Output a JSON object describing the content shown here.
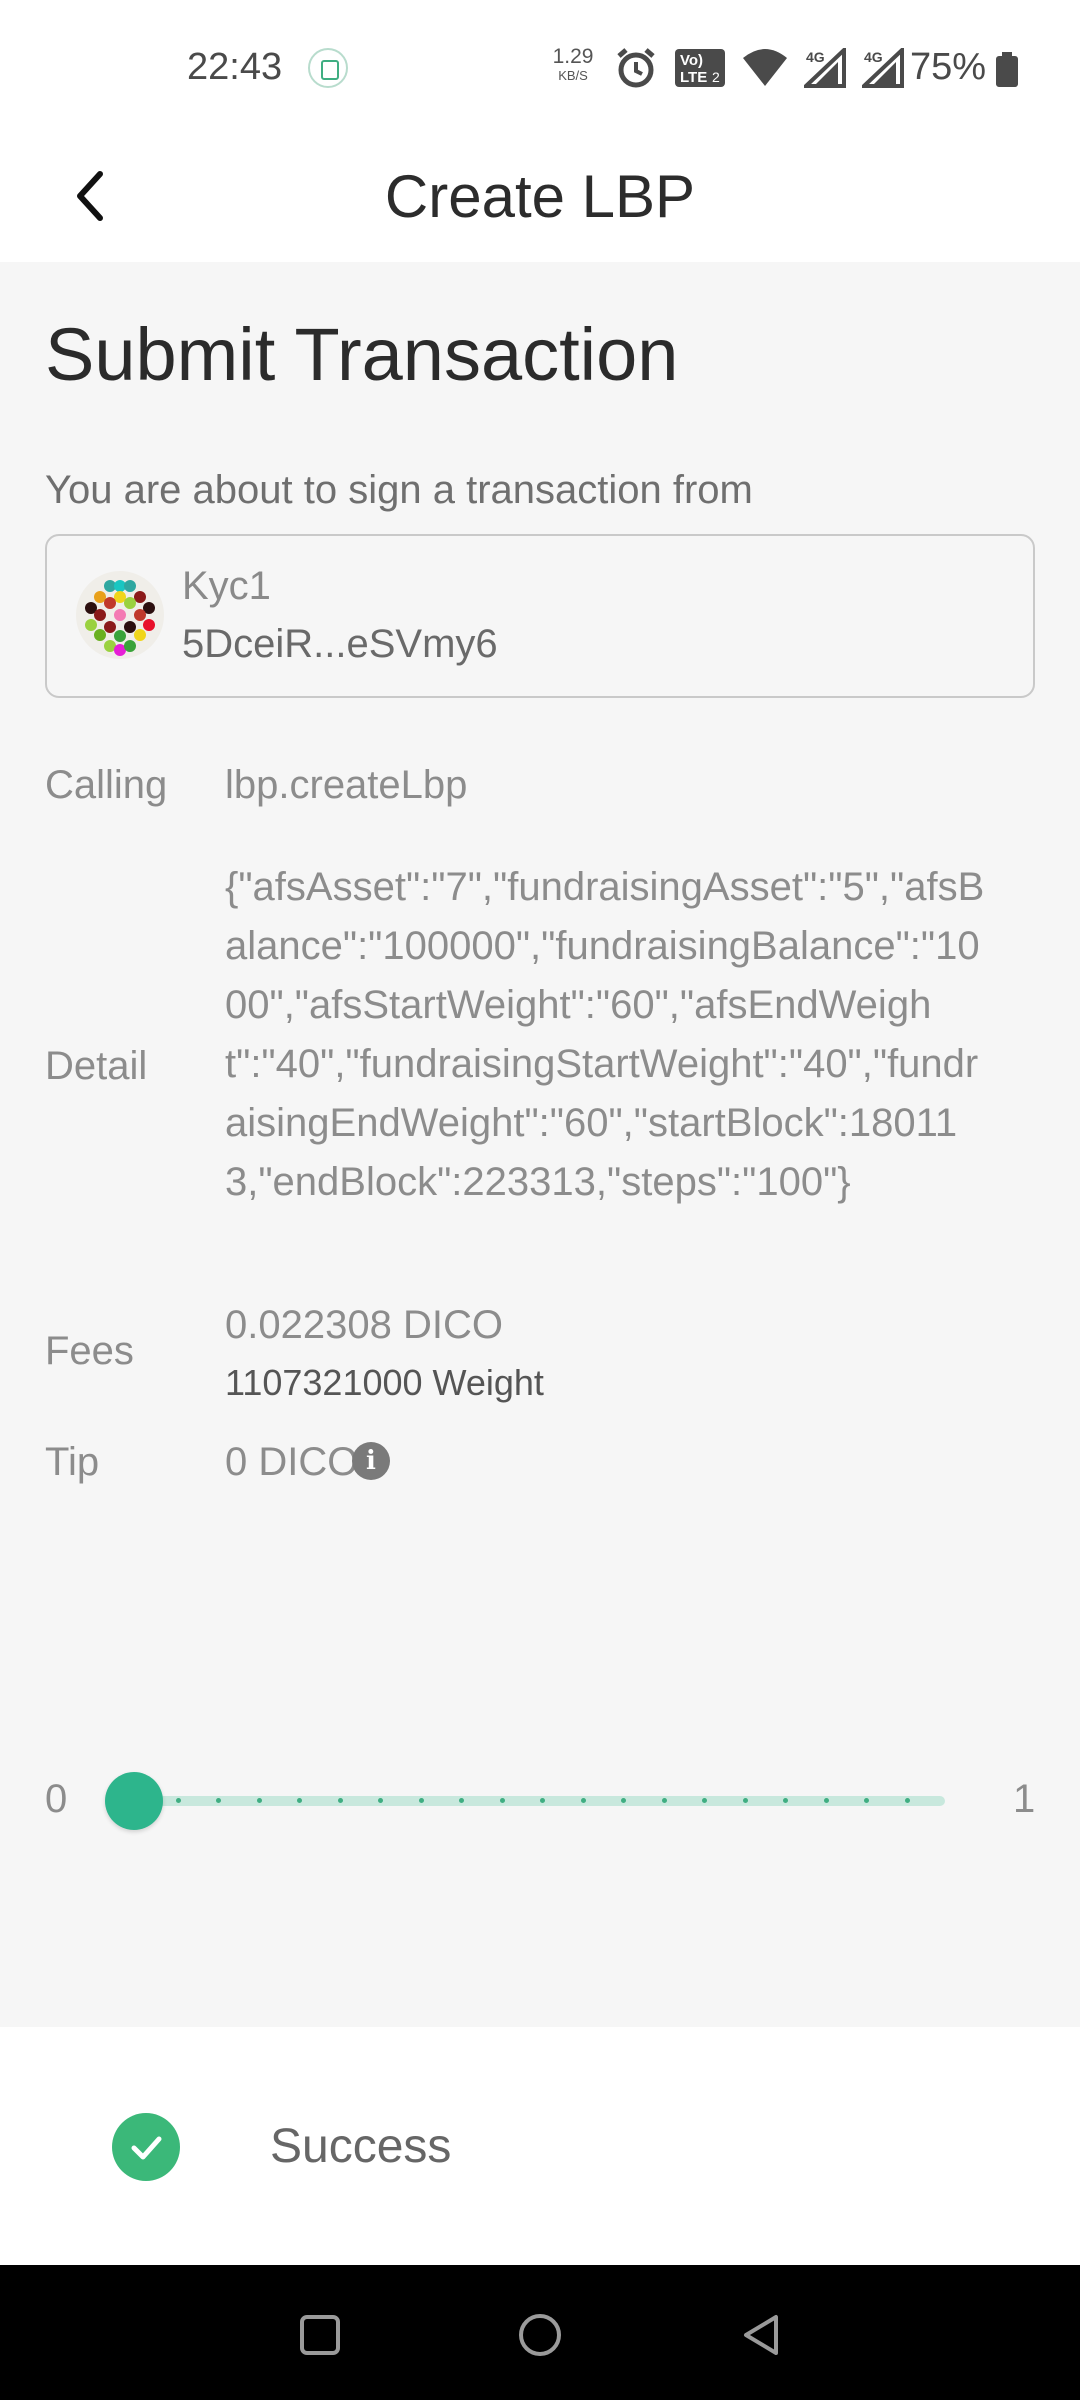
{
  "status_bar": {
    "time": "22:43",
    "net_speed_value": "1.29",
    "net_speed_unit": "KB/S",
    "volte_label": "Vo) LTE 2",
    "signal_label_1": "4G",
    "signal_label_2": "4G",
    "battery": "75%",
    "icons": [
      "app-notification-icon",
      "alarm-icon",
      "volte-icon",
      "wifi-icon",
      "signal-4g-icon",
      "signal-4g-icon",
      "battery-icon"
    ]
  },
  "app_bar": {
    "title": "Create LBP",
    "back_icon": "chevron-left-icon"
  },
  "page": {
    "heading": "Submit Transaction",
    "intro": "You are about to sign a transaction from",
    "account": {
      "name": "Kyc1",
      "address": "5DceiR...eSVmy6"
    },
    "calling_label": "Calling",
    "calling_value": "lbp.createLbp",
    "detail_label": "Detail",
    "detail_value": "{\"afsAsset\":\"7\",\"fundraisingAsset\":\"5\",\"afsBalance\":\"100000\",\"fundraisingBalance\":\"1000\",\"afsStartWeight\":\"60\",\"afsEndWeight\":\"40\",\"fundraisingStartWeight\":\"40\",\"fundraisingEndWeight\":\"60\",\"startBlock\":180113,\"endBlock\":223313,\"steps\":\"100\"}",
    "fees_label": "Fees",
    "fees_value": "0.022308 DICO",
    "fees_weight": "1107321000 Weight",
    "tip_label": "Tip",
    "tip_value": "0 DICO",
    "tip_slider": {
      "min_label": "0",
      "max_label": "1",
      "value": 0
    }
  },
  "toast": {
    "text": "Success",
    "icon": "check-circle-icon",
    "color": "#3bb879"
  },
  "colors": {
    "accent": "#2db58c",
    "track": "#c8e8dd"
  },
  "nav_bar": {
    "icons": [
      "recents-square-icon",
      "home-circle-icon",
      "back-triangle-icon"
    ]
  }
}
